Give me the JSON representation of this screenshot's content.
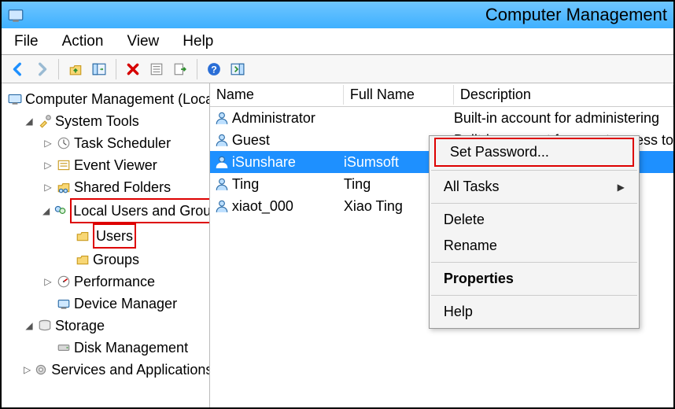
{
  "window": {
    "title": "Computer Management"
  },
  "menubar": {
    "file": "File",
    "action": "Action",
    "view": "View",
    "help": "Help"
  },
  "toolbar_icons": [
    "back",
    "forward",
    "up",
    "show-hide",
    "delete",
    "properties",
    "export",
    "help",
    "action-panel"
  ],
  "tree": {
    "root": "Computer Management (Local)",
    "system_tools": "System Tools",
    "task_scheduler": "Task Scheduler",
    "event_viewer": "Event Viewer",
    "shared_folders": "Shared Folders",
    "local_users_groups": "Local Users and Groups",
    "users": "Users",
    "groups": "Groups",
    "performance": "Performance",
    "device_manager": "Device Manager",
    "storage": "Storage",
    "disk_management": "Disk Management",
    "services_apps": "Services and Applications"
  },
  "list": {
    "headers": {
      "name": "Name",
      "full": "Full Name",
      "desc": "Description"
    },
    "rows": [
      {
        "name": "Administrator",
        "full": "",
        "desc": "Built-in account for administering "
      },
      {
        "name": "Guest",
        "full": "",
        "desc": "Built-in account for guest access to"
      },
      {
        "name": "iSunshare",
        "full": "iSumsoft",
        "desc": "",
        "selected": true
      },
      {
        "name": "Ting",
        "full": "Ting",
        "desc": ""
      },
      {
        "name": "xiaot_000",
        "full": "Xiao Ting",
        "desc": ""
      }
    ]
  },
  "context_menu": {
    "set_password": "Set Password...",
    "all_tasks": "All Tasks",
    "delete": "Delete",
    "rename": "Rename",
    "properties": "Properties",
    "help": "Help"
  }
}
